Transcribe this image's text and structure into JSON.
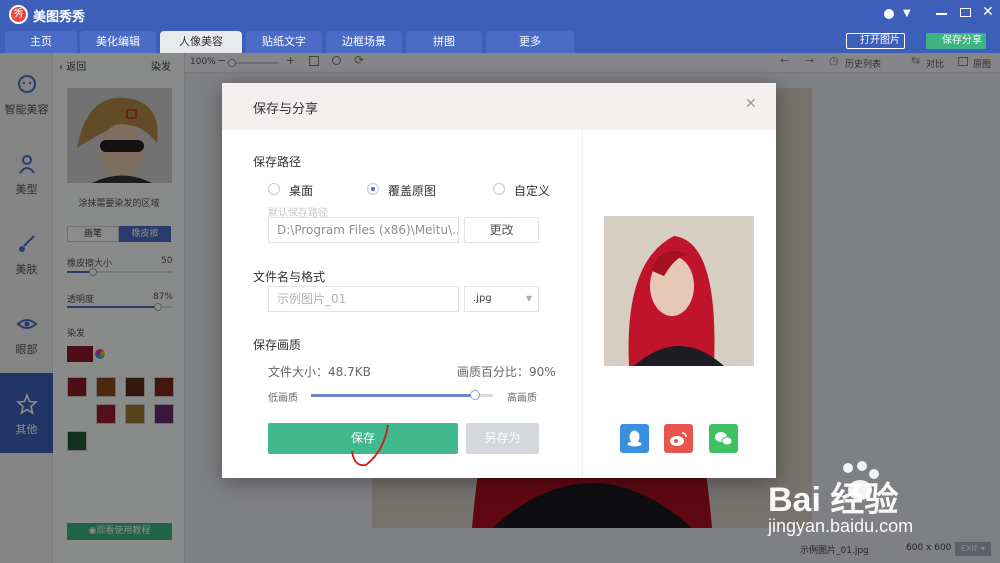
{
  "app": {
    "title": "美图秀秀",
    "logo_char": "秀"
  },
  "tabs": [
    {
      "label": "主页"
    },
    {
      "label": "美化编辑"
    },
    {
      "label": "人像美容"
    },
    {
      "label": "贴纸文字"
    },
    {
      "label": "边框场景"
    },
    {
      "label": "拼图"
    },
    {
      "label": "更多"
    }
  ],
  "header": {
    "open_label": "打开图片",
    "save_share_label": "保存分享"
  },
  "leftnav": [
    {
      "label": "智能美容"
    },
    {
      "label": "美型"
    },
    {
      "label": "美肤"
    },
    {
      "label": "眼部"
    },
    {
      "label": "其他"
    }
  ],
  "panel": {
    "back_label": "返回",
    "title": "染发",
    "hint": "涂抹需要染发的区域",
    "brush_label": "画笔",
    "eraser_label": "橡皮擦",
    "eraser_size_label": "橡皮擦大小",
    "eraser_size_value": "50",
    "eraser_size": 0.25,
    "opacity_label": "透明度",
    "opacity_value": "87%",
    "opacity": 0.87,
    "dye_label": "染发",
    "tutorial_label": "观看使用教程"
  },
  "colors": [
    "#8a1a22",
    "#8b4a1c",
    "#5c2c16",
    "#7a2a1c",
    "#2b2f3d",
    "#9b1c2c",
    "#9a7832",
    "#6a2a6a",
    "#1e5a3a"
  ],
  "toolbar": {
    "zoom": "100%",
    "history_label": "历史列表",
    "compare_label": "对比",
    "original_label": "原图"
  },
  "status": {
    "filename": "示例图片_01.jpg",
    "dimensions": "600 x 600",
    "exif": "EXIF"
  },
  "dialog": {
    "title": "保存与分享",
    "path_section": "保存路径",
    "options": [
      {
        "label": "桌面"
      },
      {
        "label": "覆盖原图"
      },
      {
        "label": "自定义"
      }
    ],
    "default_path_label": "默认保存路径",
    "path_value": "D:\\Program Files (x86)\\Meitu\\...",
    "change_label": "更改",
    "filename_section": "文件名与格式",
    "filename_placeholder": "示例图片_01",
    "format_value": ".jpg",
    "quality_section": "保存画质",
    "file_size": "文件大小：48.7KB",
    "quality_percent": "画质百分比：90%",
    "quality": 0.9,
    "low_label": "低画质",
    "high_label": "高画质",
    "save_label": "保存",
    "save_as_label": "另存为"
  },
  "watermark": {
    "brand": "Bai 经验",
    "url": "jingyan.baidu.com"
  }
}
